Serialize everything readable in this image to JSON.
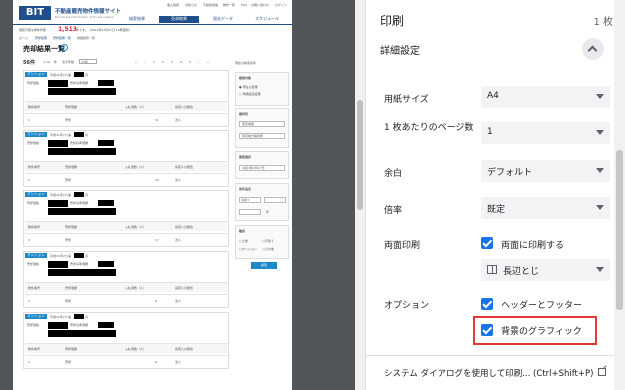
{
  "colors": {
    "accent": "#1a73e8",
    "highlight": "#e53935",
    "site_blue": "#1e4f8c",
    "tag_blue": "#1e88c8",
    "price_red": "#d23"
  },
  "site": {
    "logo": "BIT",
    "title": "不動産競売物件情報サイト",
    "subtitle": "Broadcast Information of Tri-set system",
    "nav": [
      "検索結果",
      "売却結果",
      "過去データ",
      "スケジュール"
    ],
    "top_links": [
      "個人情報",
      "お知らせ",
      "不動産用語",
      "物件一覧",
      "FAQ",
      "お問い合わせ",
      "ログイン"
    ],
    "info_label": "閲覧可能な物件件数",
    "info_count": "1,513",
    "info_suffix": "件です。（2021年03月01日 16時更新）",
    "breadcrumb": [
      "ホーム",
      "売却結果",
      "売却結果一覧",
      "地図検索一覧"
    ]
  },
  "results": {
    "heading": "売却結果一覧",
    "count": "56件",
    "range": "1-10",
    "range_suffix": "件",
    "per_page_label": "表示件数",
    "per_page_value": "10件",
    "pages": [
      "«",
      "‹",
      "1",
      "2",
      "3",
      "4",
      "5",
      "›",
      "»"
    ],
    "conditions_label": "現在の検索条件",
    "cards": [
      {
        "tag": "マンション",
        "line1": "平成31年(ケ)第",
        "line2": "円",
        "addr_label": "売却価格",
        "addr_label2": "売却基準価額",
        "cols": [
          "物件番号",
          "売却価額",
          "入札者数（人）",
          "買受人の属性"
        ],
        "vals": [
          "1",
          "売却",
          "11",
          "法人"
        ]
      },
      {
        "tag": "マンション",
        "line1": "平成31年(ケ)第",
        "line2": "円",
        "addr_label": "売却価格",
        "addr_label2": "売却基準価額",
        "cols": [
          "物件番号",
          "売却価額",
          "入札者数（人）",
          "買受人の属性"
        ],
        "vals": [
          "1",
          "売却",
          "19",
          "法人"
        ]
      },
      {
        "tag": "マンション",
        "line1": "平成31年(ケ)第",
        "line2": "円",
        "addr_label": "売却価格",
        "addr_label2": "売却基準価額",
        "cols": [
          "物件番号",
          "売却価額",
          "入札者数（人）",
          "買受人の属性"
        ],
        "vals": [
          "3",
          "売却",
          "17",
          "法人"
        ]
      },
      {
        "tag": "マンション",
        "line1": "平成31年(ケ)第",
        "line2": "円",
        "addr_label": "売却価格",
        "addr_label2": "売却基準価額",
        "cols": [
          "物件番号",
          "売却価額",
          "入札者数（人）",
          "買受人の属性"
        ],
        "vals": [
          "1",
          "売却",
          "9",
          "法人"
        ]
      },
      {
        "tag": "マンション",
        "line1": "平成31年(ケ)第",
        "line2": "円",
        "addr_label": "売却価格",
        "addr_label2": "売却基準価額",
        "cols": [
          "物件番号",
          "売却価額",
          "入札者数（人）",
          "買受人の属性"
        ],
        "vals": [
          "1",
          "売却",
          "6",
          "法人"
        ]
      }
    ],
    "sidebar": {
      "title1": "検索対象",
      "opt1": "現在の結果",
      "opt2": "明細設定結果",
      "title2": "裁判所",
      "sel1": "東京地裁",
      "sel2": "東京地方裁判所",
      "title3": "期間選択",
      "date": "令和3年2月17日",
      "title4": "条件指定",
      "from": "令和3",
      "to": "年",
      "title5": "種別",
      "types": [
        "土地",
        "戸建て",
        "マンション",
        "その他"
      ],
      "search": "検索"
    }
  },
  "print": {
    "title": "印刷",
    "pages": "1 枚",
    "details": "詳細設定",
    "paper_label": "用紙サイズ",
    "paper_value": "A4",
    "pps_label": "1 枚あたりのページ数",
    "pps_value": "1",
    "margin_label": "余白",
    "margin_value": "デフォルト",
    "quality_label": "倍率",
    "quality_value": "既定",
    "duplex_label": "両面印刷",
    "duplex_check": "両面に印刷する",
    "duplex_value": "長辺とじ",
    "options_label": "オプション",
    "opt_header": "ヘッダーとフッター",
    "opt_bg": "背景のグラフィック",
    "system_link": "システム ダイアログを使用して印刷... (Ctrl+Shift+P)"
  }
}
